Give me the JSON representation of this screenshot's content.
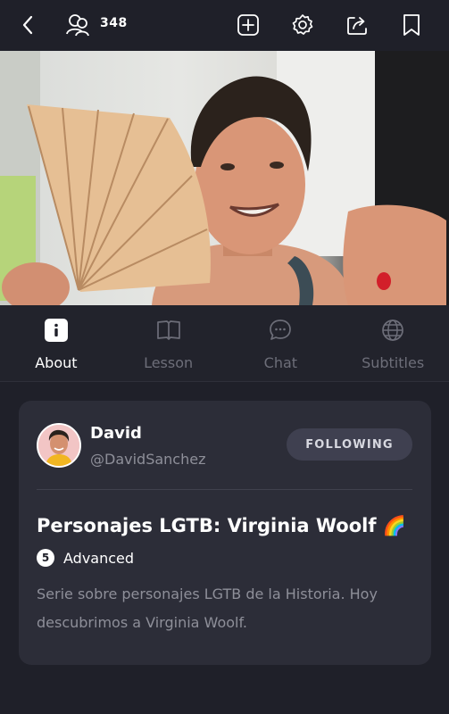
{
  "topbar": {
    "viewer_count": "348",
    "icons": [
      "back-chevron-icon",
      "viewers-icon",
      "add-icon",
      "settings-icon",
      "share-icon",
      "bookmark-icon"
    ]
  },
  "tabs": [
    {
      "label": "About",
      "icon": "info-icon",
      "active": true
    },
    {
      "label": "Lesson",
      "icon": "book-icon",
      "active": false
    },
    {
      "label": "Chat",
      "icon": "chat-icon",
      "active": false
    },
    {
      "label": "Subtitles",
      "icon": "globe-icon",
      "active": false
    }
  ],
  "author": {
    "name": "David",
    "handle": "@DavidSanchez",
    "follow_label": "FOLLOWING"
  },
  "lesson": {
    "title": "Personajes LGTB: Virginia Woolf 🌈",
    "level_number": "5",
    "level_label": "Advanced",
    "description": "Serie sobre personajes LGTB de la Historia. Hoy descubrimos a Virginia Woolf."
  },
  "colors": {
    "background": "#1f2029",
    "card": "#2c2d38",
    "follow_button": "#3f4050",
    "muted_text": "#8e8f99",
    "inactive_tab": "#6d6e79"
  }
}
